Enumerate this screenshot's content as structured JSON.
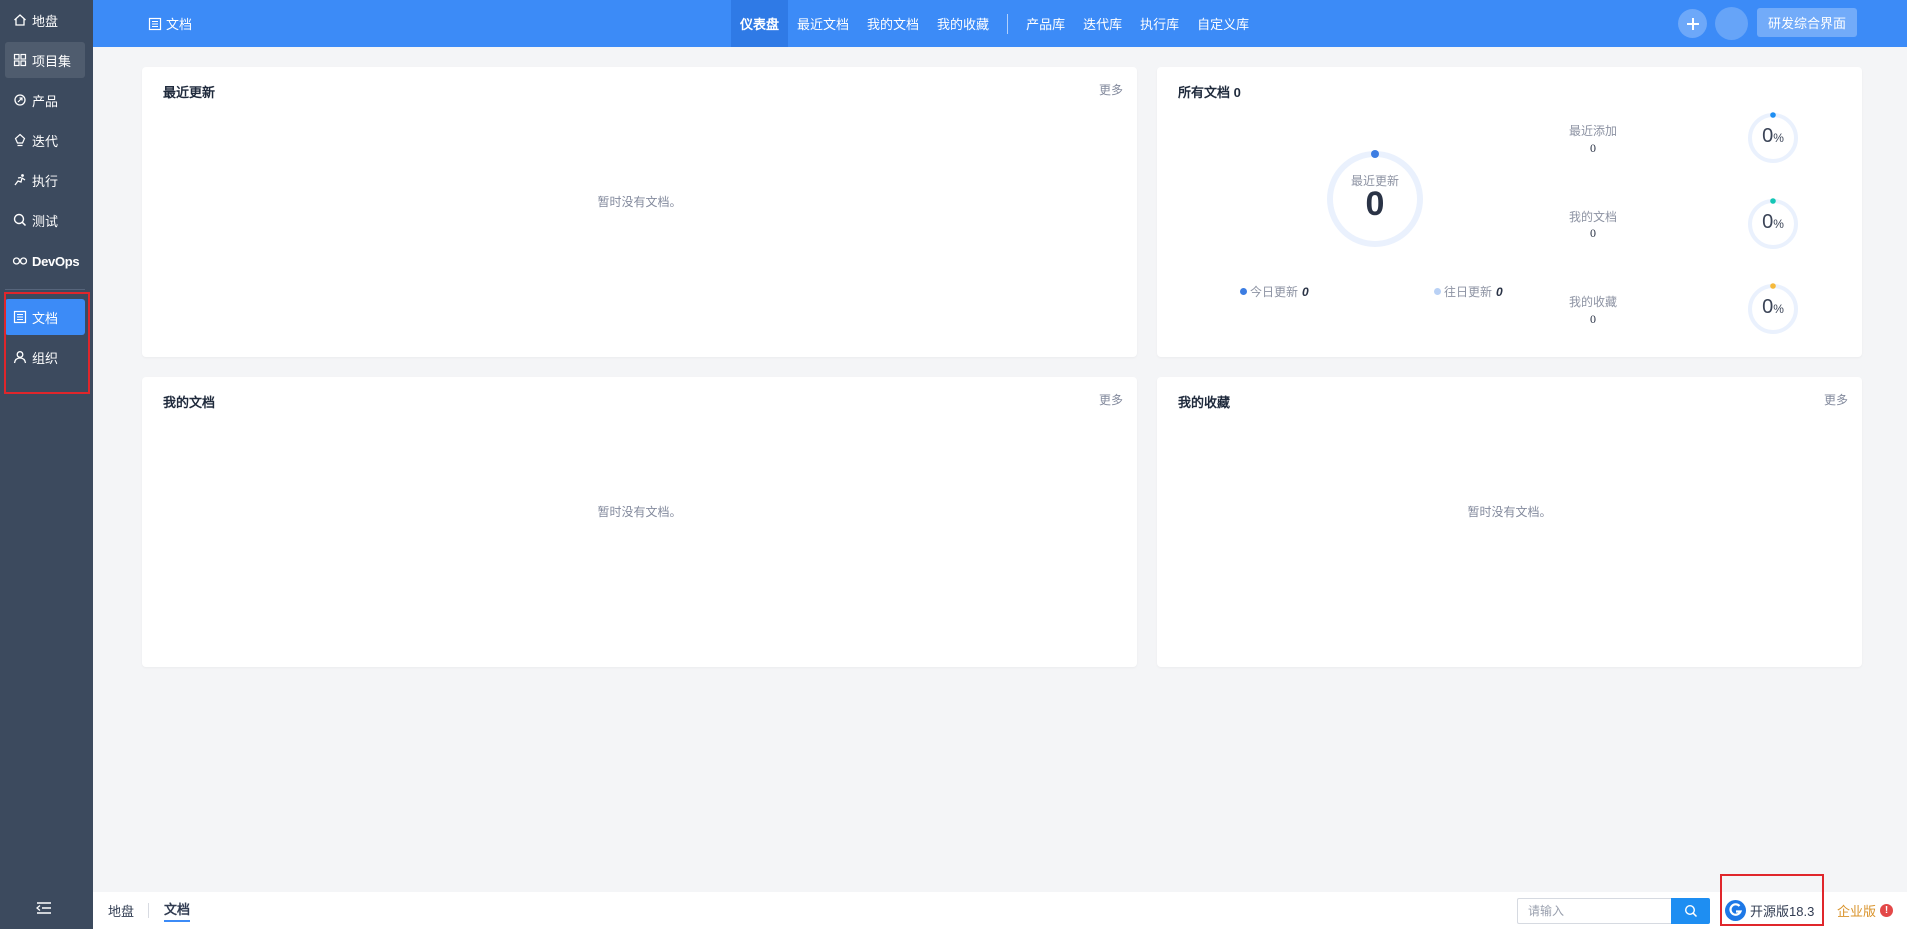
{
  "sidebar": {
    "items": [
      {
        "label": "地盘",
        "icon": "home-icon"
      },
      {
        "label": "项目集",
        "icon": "grid-icon"
      },
      {
        "label": "产品",
        "icon": "product-icon"
      },
      {
        "label": "迭代",
        "icon": "iteration-icon"
      },
      {
        "label": "执行",
        "icon": "run-icon"
      },
      {
        "label": "测试",
        "icon": "search-icon"
      },
      {
        "label": "DevOps",
        "icon": "infinity-icon"
      },
      {
        "label": "文档",
        "icon": "doc-icon"
      },
      {
        "label": "组织",
        "icon": "user-icon"
      }
    ],
    "active": "文档"
  },
  "topbar": {
    "app_title": "文档",
    "tabs": [
      "仪表盘",
      "最近文档",
      "我的文档",
      "我的收藏",
      "产品库",
      "迭代库",
      "执行库",
      "自定义库"
    ],
    "active_tab": "仪表盘",
    "switch_button": "研发综合界面"
  },
  "panels": {
    "recent": {
      "title": "最近更新",
      "more": "更多",
      "empty": "暂时没有文档。"
    },
    "stats": {
      "title": "所有文档 0",
      "ring_label": "最近更新",
      "ring_value": "0",
      "today_label": "今日更新",
      "today_value": "0",
      "past_label": "往日更新",
      "past_value": "0",
      "items": [
        {
          "label": "最近添加",
          "value": "0",
          "percent": "0",
          "unit": "%",
          "color": "#3c8bf7"
        },
        {
          "label": "我的文档",
          "value": "0",
          "percent": "0",
          "unit": "%",
          "color": "#14c6b5"
        },
        {
          "label": "我的收藏",
          "value": "0",
          "percent": "0",
          "unit": "%",
          "color": "#f5b93c"
        }
      ]
    },
    "mydocs": {
      "title": "我的文档",
      "more": "更多",
      "empty": "暂时没有文档。"
    },
    "favorites": {
      "title": "我的收藏",
      "more": "更多",
      "empty": "暂时没有文档。"
    }
  },
  "footer": {
    "breadcrumb": [
      "地盘",
      "文档"
    ],
    "search_placeholder": "请输入",
    "edition": "开源版18.3",
    "enterprise": "企业版",
    "enterprise_badge": "!"
  },
  "colors": {
    "sidebar_bg": "#3c4a5e",
    "topbar_bg": "#3c8bf7",
    "active_nav": "#3c8bf7",
    "highlight_box": "#e0262b"
  }
}
